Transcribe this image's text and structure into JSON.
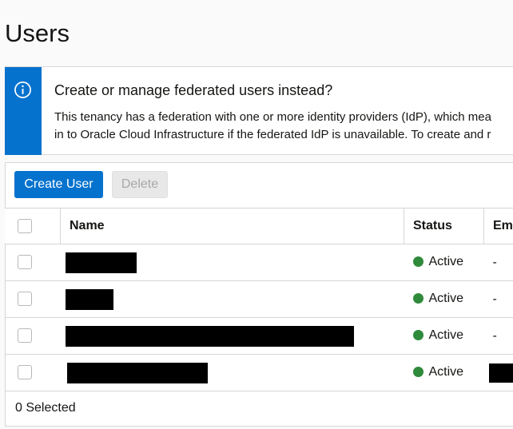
{
  "page": {
    "title": "Users"
  },
  "banner": {
    "icon": "info-circle-icon",
    "title": "Create or manage federated users instead?",
    "line1": "This tenancy has a federation with one or more identity providers (IdP), which mea",
    "line2": "in to Oracle Cloud Infrastructure if the federated IdP is unavailable. To create and r",
    "accent_color": "#0572ce"
  },
  "toolbar": {
    "create_label": "Create User",
    "delete_label": "Delete"
  },
  "table": {
    "headers": {
      "name": "Name",
      "status": "Status",
      "email": "Email"
    },
    "rows": [
      {
        "status": "Active",
        "email": "-"
      },
      {
        "status": "Active",
        "email": "-"
      },
      {
        "status": "Active",
        "email": "-"
      },
      {
        "status": "Active",
        "email": ""
      }
    ],
    "status_color": "#2f8a3c"
  },
  "footer": {
    "selected_text": "0 Selected"
  }
}
